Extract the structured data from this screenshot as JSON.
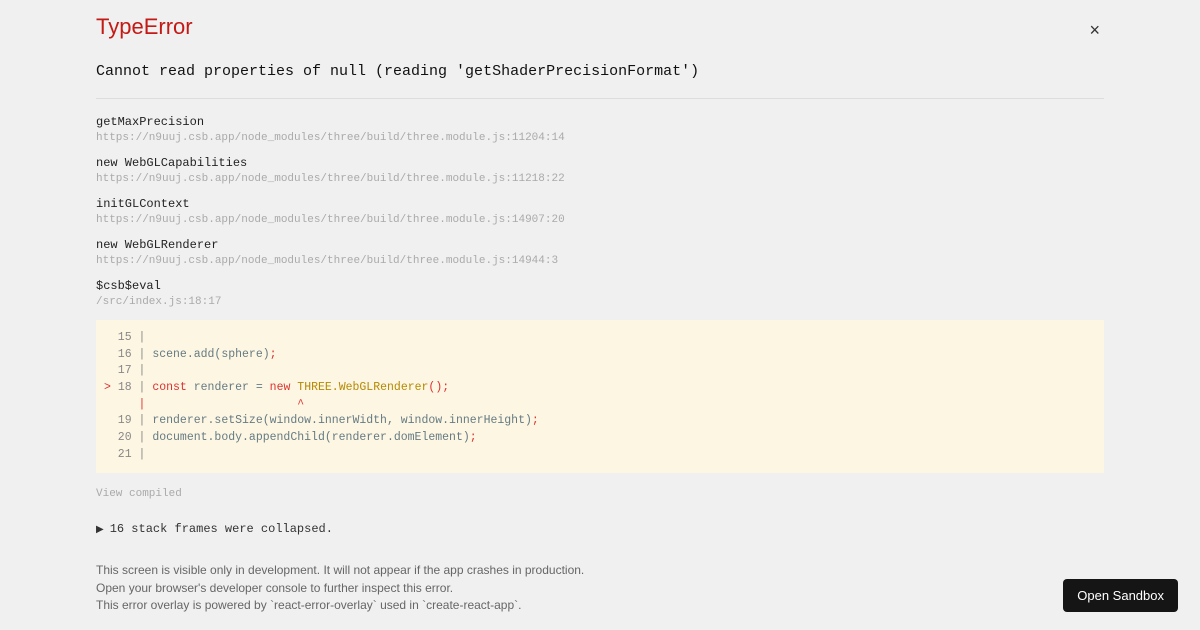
{
  "error": {
    "type": "TypeError",
    "message": "Cannot read properties of null (reading 'getShaderPrecisionFormat')"
  },
  "stack": [
    {
      "name": "getMaxPrecision",
      "location": "https://n9uuj.csb.app/node_modules/three/build/three.module.js:11204:14"
    },
    {
      "name": "new WebGLCapabilities",
      "location": "https://n9uuj.csb.app/node_modules/three/build/three.module.js:11218:22"
    },
    {
      "name": "initGLContext",
      "location": "https://n9uuj.csb.app/node_modules/three/build/three.module.js:14907:20"
    },
    {
      "name": "new WebGLRenderer",
      "location": "https://n9uuj.csb.app/node_modules/three/build/three.module.js:14944:3"
    },
    {
      "name": "$csb$eval",
      "location": "/src/index.js:18:17"
    }
  ],
  "code": {
    "lines": {
      "l15": "  15 | ",
      "l16_gutter": "  16 | ",
      "l16_code": "scene.add(sphere)",
      "l16_semi": ";",
      "l17": "  17 | ",
      "l18_marker": "> ",
      "l18_gutter": "18 | ",
      "l18_const": "const",
      "l18_renderer": " renderer ",
      "l18_eq": "=",
      "l18_sp": " ",
      "l18_new": "new",
      "l18_sp2": " ",
      "l18_class": "THREE.WebGLRenderer",
      "l18_call": "();",
      "caret": "     |                      ^",
      "l19_gutter": "  19 | ",
      "l19_code": "renderer.setSize(window.innerWidth, window.innerHeight)",
      "l19_semi": ";",
      "l20_gutter": "  20 | ",
      "l20_code": "document.body.appendChild(renderer.domElement)",
      "l20_semi": ";",
      "l21": "  21 | "
    }
  },
  "view_compiled": "View compiled",
  "collapsed": "16 stack frames were collapsed.",
  "footer": {
    "line1": "This screen is visible only in development. It will not appear if the app crashes in production.",
    "line2": "Open your browser's developer console to further inspect this error.",
    "line3": "This error overlay is powered by `react-error-overlay` used in `create-react-app`."
  },
  "close_symbol": "×",
  "open_sandbox": "Open Sandbox"
}
